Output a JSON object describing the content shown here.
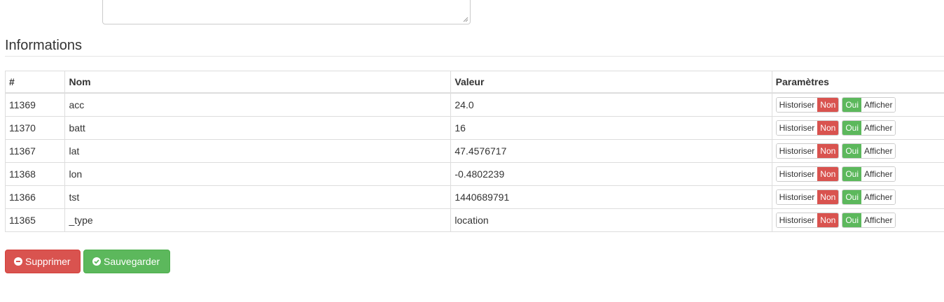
{
  "section": {
    "title": "Informations"
  },
  "table": {
    "headers": {
      "id": "#",
      "nom": "Nom",
      "valeur": "Valeur",
      "parametres": "Paramètres"
    },
    "rows": [
      {
        "id": "11369",
        "nom": "acc",
        "valeur": "24.0"
      },
      {
        "id": "11370",
        "nom": "batt",
        "valeur": "16"
      },
      {
        "id": "11367",
        "nom": "lat",
        "valeur": "47.4576717"
      },
      {
        "id": "11368",
        "nom": "lon",
        "valeur": "-0.4802239"
      },
      {
        "id": "11366",
        "nom": "tst",
        "valeur": "1440689791"
      },
      {
        "id": "11365",
        "nom": "_type",
        "valeur": "location"
      }
    ],
    "toggles": {
      "historiser_label": "Historiser",
      "historiser_state": "Non",
      "afficher_state": "Oui",
      "afficher_label": "Afficher"
    }
  },
  "buttons": {
    "delete_label": "Supprimer",
    "save_label": "Sauvegarder"
  },
  "colors": {
    "danger": "#d9534f",
    "success": "#5cb85c",
    "border": "#dddddd"
  },
  "icons": {
    "delete": "minus-circle-icon",
    "save": "check-circle-icon"
  }
}
